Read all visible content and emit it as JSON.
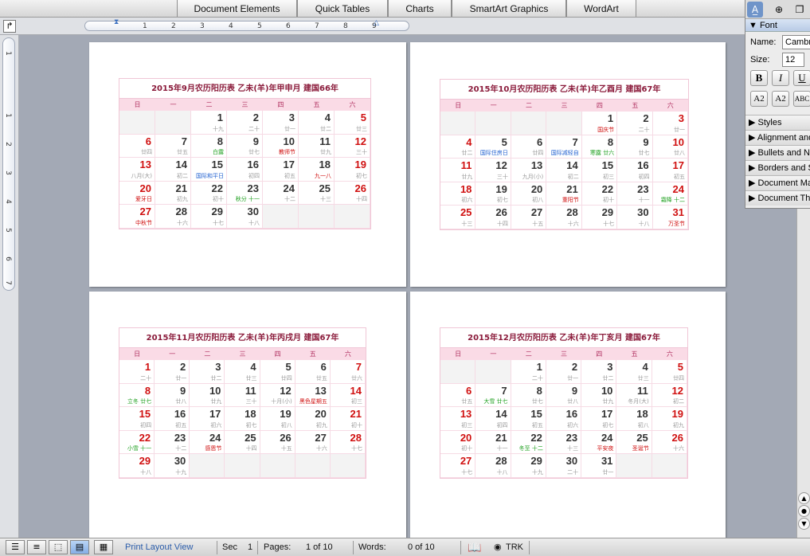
{
  "ribbon": {
    "tabs": [
      "Document Elements",
      "Quick Tables",
      "Charts",
      "SmartArt Graphics",
      "WordArt"
    ]
  },
  "ruler": {
    "numbers": [
      "1",
      "2",
      "3",
      "4",
      "5",
      "6",
      "7",
      "8",
      "9"
    ],
    "vnumbers": [
      "1",
      "1",
      "2",
      "3",
      "4",
      "5",
      "6",
      "7"
    ]
  },
  "font_panel": {
    "header": "Font",
    "name_label": "Name:",
    "name_value": "Cambria",
    "size_label": "Size:",
    "size_value": "12",
    "style_buttons": [
      "B",
      "I",
      "U"
    ],
    "effect_buttons": [
      "A2",
      "A2",
      "ABC"
    ],
    "sections": [
      "Styles",
      "Alignment and Spacing",
      "Bullets and Numbering",
      "Borders and Shading",
      "Document Margins",
      "Document Theme"
    ]
  },
  "calendar": {
    "weekdays": [
      "日",
      "一",
      "二",
      "三",
      "四",
      "五",
      "六"
    ],
    "months": [
      {
        "title": "2015年9月农历阳历表 乙未(羊)年甲申月 建国66年",
        "start": 2,
        "days": [
          {
            "d": "1",
            "l": "十九"
          },
          {
            "d": "2",
            "l": "二十"
          },
          {
            "d": "3",
            "l": "廿一"
          },
          {
            "d": "4",
            "l": "廿二"
          },
          {
            "d": "5",
            "l": "廿三",
            "red": true
          },
          {
            "d": "6",
            "l": "廿四",
            "red": true
          },
          {
            "d": "7",
            "l": "廿五"
          },
          {
            "d": "8",
            "l": "白露",
            "lc": "green"
          },
          {
            "d": "9",
            "l": "廿七"
          },
          {
            "d": "10",
            "l": "教师节",
            "lc": "red"
          },
          {
            "d": "11",
            "l": "廿九"
          },
          {
            "d": "12",
            "l": "三十",
            "red": true
          },
          {
            "d": "13",
            "l": "八月(大)",
            "red": true
          },
          {
            "d": "14",
            "l": "初二"
          },
          {
            "d": "15",
            "l": "国际和平日",
            "lc": "blue"
          },
          {
            "d": "16",
            "l": "初四"
          },
          {
            "d": "17",
            "l": "初五"
          },
          {
            "d": "18",
            "l": "九一八",
            "lc": "red"
          },
          {
            "d": "19",
            "l": "初七",
            "red": true
          },
          {
            "d": "20",
            "l": "爱牙日",
            "red": true,
            "lc": "red"
          },
          {
            "d": "21",
            "l": "初九"
          },
          {
            "d": "22",
            "l": "初十"
          },
          {
            "d": "23",
            "l": "秋分 十一",
            "lc": "green"
          },
          {
            "d": "24",
            "l": "十二"
          },
          {
            "d": "25",
            "l": "十三"
          },
          {
            "d": "26",
            "l": "十四",
            "red": true
          },
          {
            "d": "27",
            "l": "中秋节",
            "red": true,
            "lc": "red"
          },
          {
            "d": "28",
            "l": "十六"
          },
          {
            "d": "29",
            "l": "十七"
          },
          {
            "d": "30",
            "l": "十八"
          }
        ]
      },
      {
        "title": "2015年10月农历阳历表 乙未(羊)年乙酉月 建国67年",
        "start": 4,
        "days": [
          {
            "d": "1",
            "l": "国庆节",
            "lc": "red"
          },
          {
            "d": "2",
            "l": "二十"
          },
          {
            "d": "3",
            "l": "廿一",
            "red": true
          },
          {
            "d": "4",
            "l": "廿二",
            "red": true
          },
          {
            "d": "5",
            "l": "国际住房日",
            "lc": "blue"
          },
          {
            "d": "6",
            "l": "廿四"
          },
          {
            "d": "7",
            "l": "国际减轻自",
            "lc": "blue"
          },
          {
            "d": "8",
            "l": "寒露 廿六",
            "lc": "green"
          },
          {
            "d": "9",
            "l": "廿七"
          },
          {
            "d": "10",
            "l": "廿八",
            "red": true
          },
          {
            "d": "11",
            "l": "廿九",
            "red": true
          },
          {
            "d": "12",
            "l": "三十"
          },
          {
            "d": "13",
            "l": "九月(小)"
          },
          {
            "d": "14",
            "l": "初二"
          },
          {
            "d": "15",
            "l": "初三"
          },
          {
            "d": "16",
            "l": "初四"
          },
          {
            "d": "17",
            "l": "初五",
            "red": true
          },
          {
            "d": "18",
            "l": "初六",
            "red": true
          },
          {
            "d": "19",
            "l": "初七"
          },
          {
            "d": "20",
            "l": "初八"
          },
          {
            "d": "21",
            "l": "重阳节",
            "lc": "red"
          },
          {
            "d": "22",
            "l": "初十"
          },
          {
            "d": "23",
            "l": "十一"
          },
          {
            "d": "24",
            "l": "霜降 十二",
            "red": true,
            "lc": "green"
          },
          {
            "d": "25",
            "l": "十三",
            "red": true
          },
          {
            "d": "26",
            "l": "十四"
          },
          {
            "d": "27",
            "l": "十五"
          },
          {
            "d": "28",
            "l": "十六"
          },
          {
            "d": "29",
            "l": "十七"
          },
          {
            "d": "30",
            "l": "十八"
          },
          {
            "d": "31",
            "l": "万圣节",
            "red": true,
            "lc": "red"
          }
        ]
      },
      {
        "title": "2015年11月农历阳历表 乙未(羊)年丙戌月 建国67年",
        "start": 0,
        "days": [
          {
            "d": "1",
            "l": "二十",
            "red": true
          },
          {
            "d": "2",
            "l": "廿一"
          },
          {
            "d": "3",
            "l": "廿二"
          },
          {
            "d": "4",
            "l": "廿三"
          },
          {
            "d": "5",
            "l": "廿四"
          },
          {
            "d": "6",
            "l": "廿五"
          },
          {
            "d": "7",
            "l": "廿六",
            "red": true
          },
          {
            "d": "8",
            "l": "立冬 廿七",
            "red": true,
            "lc": "green"
          },
          {
            "d": "9",
            "l": "廿八"
          },
          {
            "d": "10",
            "l": "廿九"
          },
          {
            "d": "11",
            "l": "三十"
          },
          {
            "d": "12",
            "l": "十月(小)"
          },
          {
            "d": "13",
            "l": "黑色星期五",
            "lc": "red"
          },
          {
            "d": "14",
            "l": "初三",
            "red": true
          },
          {
            "d": "15",
            "l": "初四",
            "red": true
          },
          {
            "d": "16",
            "l": "初五"
          },
          {
            "d": "17",
            "l": "初六"
          },
          {
            "d": "18",
            "l": "初七"
          },
          {
            "d": "19",
            "l": "初八"
          },
          {
            "d": "20",
            "l": "初九"
          },
          {
            "d": "21",
            "l": "初十",
            "red": true
          },
          {
            "d": "22",
            "l": "小雪 十一",
            "red": true,
            "lc": "green"
          },
          {
            "d": "23",
            "l": "十二"
          },
          {
            "d": "24",
            "l": "感恩节",
            "lc": "red"
          },
          {
            "d": "25",
            "l": "十四"
          },
          {
            "d": "26",
            "l": "十五"
          },
          {
            "d": "27",
            "l": "十六"
          },
          {
            "d": "28",
            "l": "十七",
            "red": true
          },
          {
            "d": "29",
            "l": "十八",
            "red": true
          },
          {
            "d": "30",
            "l": "十九"
          }
        ]
      },
      {
        "title": "2015年12月农历阳历表 乙未(羊)年丁亥月 建国67年",
        "start": 2,
        "days": [
          {
            "d": "1",
            "l": "二十"
          },
          {
            "d": "2",
            "l": "廿一"
          },
          {
            "d": "3",
            "l": "廿二"
          },
          {
            "d": "4",
            "l": "廿三"
          },
          {
            "d": "5",
            "l": "廿四",
            "red": true
          },
          {
            "d": "6",
            "l": "廿五",
            "red": true
          },
          {
            "d": "7",
            "l": "大雪 廿七",
            "lc": "green"
          },
          {
            "d": "8",
            "l": "廿七"
          },
          {
            "d": "9",
            "l": "廿八"
          },
          {
            "d": "10",
            "l": "廿九"
          },
          {
            "d": "11",
            "l": "冬月(大)"
          },
          {
            "d": "12",
            "l": "初二",
            "red": true
          },
          {
            "d": "13",
            "l": "初三",
            "red": true
          },
          {
            "d": "14",
            "l": "初四"
          },
          {
            "d": "15",
            "l": "初五"
          },
          {
            "d": "16",
            "l": "初六"
          },
          {
            "d": "17",
            "l": "初七"
          },
          {
            "d": "18",
            "l": "初八"
          },
          {
            "d": "19",
            "l": "初九",
            "red": true
          },
          {
            "d": "20",
            "l": "初十",
            "red": true
          },
          {
            "d": "21",
            "l": "十一"
          },
          {
            "d": "22",
            "l": "冬至 十二",
            "lc": "green"
          },
          {
            "d": "23",
            "l": "十三"
          },
          {
            "d": "24",
            "l": "平安夜",
            "lc": "red"
          },
          {
            "d": "25",
            "l": "圣诞节",
            "lc": "red"
          },
          {
            "d": "26",
            "l": "十六",
            "red": true
          },
          {
            "d": "27",
            "l": "十七",
            "red": true
          },
          {
            "d": "28",
            "l": "十八"
          },
          {
            "d": "29",
            "l": "十九"
          },
          {
            "d": "30",
            "l": "二十"
          },
          {
            "d": "31",
            "l": "廿一"
          }
        ]
      }
    ]
  },
  "status": {
    "view": "Print Layout View",
    "sec_label": "Sec",
    "sec_value": "1",
    "pages_label": "Pages:",
    "pages_value": "1 of 10",
    "words_label": "Words:",
    "words_value": "0 of 10",
    "trk": "TRK"
  }
}
